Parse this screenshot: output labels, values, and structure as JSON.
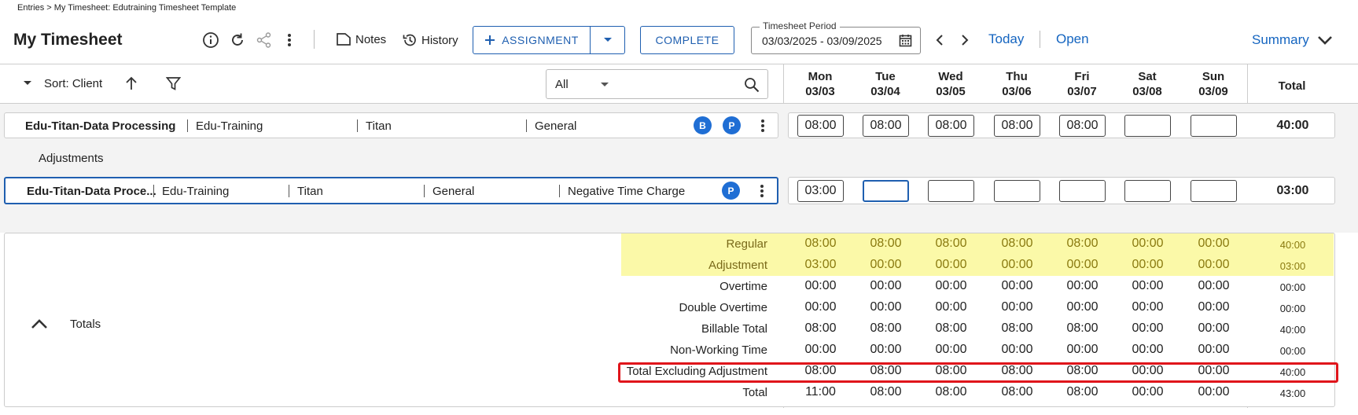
{
  "breadcrumb": "Entries > My Timesheet: Edutraining Timesheet Template",
  "page_title": "My Timesheet",
  "toolbar": {
    "notes_label": "Notes",
    "history_label": "History",
    "assignment_label": "ASSIGNMENT",
    "complete_label": "COMPLETE",
    "period_label": "Timesheet Period",
    "period_value": "03/03/2025 - 03/09/2025",
    "today_label": "Today",
    "open_label": "Open",
    "summary_label": "Summary"
  },
  "sort": {
    "label": "Sort: Client",
    "filter_value": "All"
  },
  "days": [
    {
      "name": "Mon",
      "date": "03/03"
    },
    {
      "name": "Tue",
      "date": "03/04"
    },
    {
      "name": "Wed",
      "date": "03/05"
    },
    {
      "name": "Thu",
      "date": "03/06"
    },
    {
      "name": "Fri",
      "date": "03/07"
    },
    {
      "name": "Sat",
      "date": "03/08"
    },
    {
      "name": "Sun",
      "date": "03/09"
    }
  ],
  "total_header": "Total",
  "rows": [
    {
      "project": "Edu-Titan-Data Processing",
      "training": "Edu-Training",
      "client": "Titan",
      "category": "General",
      "badges": [
        "B",
        "P"
      ],
      "hours": [
        "08:00",
        "08:00",
        "08:00",
        "08:00",
        "08:00",
        "",
        ""
      ],
      "total": "40:00"
    }
  ],
  "adjustments_label": "Adjustments",
  "adjustment_rows": [
    {
      "project": "Edu-Titan-Data Proce...",
      "training": "Edu-Training",
      "client": "Titan",
      "category": "General",
      "charge": "Negative Time Charge",
      "badges": [
        "P"
      ],
      "hours": [
        "03:00",
        "",
        "",
        "",
        "",
        "",
        ""
      ],
      "total": "03:00"
    }
  ],
  "totals": {
    "label": "Totals",
    "rows": [
      {
        "label": "Regular",
        "highlight": true,
        "values": [
          "08:00",
          "08:00",
          "08:00",
          "08:00",
          "08:00",
          "00:00",
          "00:00"
        ],
        "total": "40:00"
      },
      {
        "label": "Adjustment",
        "highlight": true,
        "values": [
          "03:00",
          "00:00",
          "00:00",
          "00:00",
          "00:00",
          "00:00",
          "00:00"
        ],
        "total": "03:00"
      },
      {
        "label": "Overtime",
        "highlight": false,
        "values": [
          "00:00",
          "00:00",
          "00:00",
          "00:00",
          "00:00",
          "00:00",
          "00:00"
        ],
        "total": "00:00"
      },
      {
        "label": "Double Overtime",
        "highlight": false,
        "values": [
          "00:00",
          "00:00",
          "00:00",
          "00:00",
          "00:00",
          "00:00",
          "00:00"
        ],
        "total": "00:00"
      },
      {
        "label": "Billable Total",
        "highlight": false,
        "values": [
          "08:00",
          "08:00",
          "08:00",
          "08:00",
          "08:00",
          "00:00",
          "00:00"
        ],
        "total": "40:00"
      },
      {
        "label": "Non-Working Time",
        "highlight": false,
        "values": [
          "00:00",
          "00:00",
          "00:00",
          "00:00",
          "00:00",
          "00:00",
          "00:00"
        ],
        "total": "00:00"
      },
      {
        "label": "Total Excluding Adjustment",
        "highlight": false,
        "outlined": true,
        "values": [
          "08:00",
          "08:00",
          "08:00",
          "08:00",
          "08:00",
          "00:00",
          "00:00"
        ],
        "total": "40:00"
      },
      {
        "label": "Total",
        "highlight": false,
        "values": [
          "11:00",
          "08:00",
          "08:00",
          "08:00",
          "08:00",
          "00:00",
          "00:00"
        ],
        "total": "43:00"
      }
    ]
  },
  "colors": {
    "accent": "#1f5fb0",
    "badge": "#1f6ed4",
    "highlight": "#fbf9a8",
    "outline": "#e0151b"
  }
}
